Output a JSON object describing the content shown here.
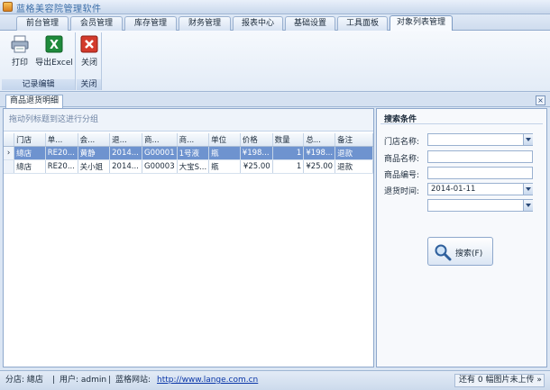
{
  "app": {
    "title": "蓝格美容院管理软件"
  },
  "tabs": [
    "前台管理",
    "会员管理",
    "库存管理",
    "财务管理",
    "报表中心",
    "基础设置",
    "工具面板",
    "对象列表管理"
  ],
  "ribbon": {
    "buttons": {
      "print": "打印",
      "export": "导出Excel",
      "close": "关闭"
    },
    "groups": {
      "edit": "记录编辑",
      "close": "关闭"
    }
  },
  "document": {
    "tab": "商品退货明细",
    "close": "×"
  },
  "grid": {
    "group_hint": "拖动列标题到这进行分组",
    "columns": [
      "门店",
      "单...",
      "会...",
      "退...",
      "商...",
      "商...",
      "单位",
      "价格",
      "数量",
      "总...",
      "备注"
    ],
    "rows": [
      {
        "indicator": "›",
        "cells": [
          "總店",
          "RE20...",
          "黄静",
          "2014...",
          "G00001",
          "1号液",
          "瓶",
          "¥198...",
          "1",
          "¥198...",
          "退款"
        ]
      },
      {
        "indicator": "",
        "cells": [
          "總店",
          "RE20...",
          "关小姐",
          "2014...",
          "G00003",
          "大宝S...",
          "瓶",
          "¥25.00",
          "1",
          "¥25.00",
          "退款"
        ]
      }
    ]
  },
  "search": {
    "title": "搜索条件",
    "labels": {
      "store": "门店名称:",
      "product_name": "商品名称:",
      "product_code": "商品编号:",
      "return_time": "退货时间:"
    },
    "values": {
      "store": "",
      "product_name": "",
      "product_code": "",
      "date_from": "2014-01-11",
      "date_to": ""
    },
    "button": "搜索(F)"
  },
  "status": {
    "store": "分店: 總店",
    "user": "用户: admin",
    "site_label": "蓝格网站:",
    "site_url": "http://www.lange.com.cn",
    "upload": "还有 0 幅图片未上传",
    "upload_suffix": "»"
  }
}
